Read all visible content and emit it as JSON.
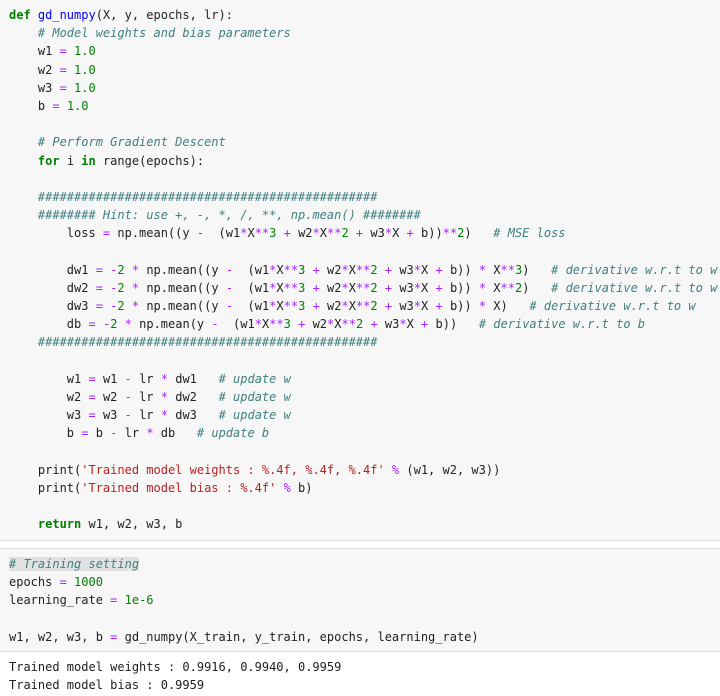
{
  "cell1": {
    "lines": [
      [
        {
          "t": "def ",
          "c": "k"
        },
        {
          "t": "gd_numpy",
          "c": "fn"
        },
        {
          "t": "(X, y, epochs, lr):"
        }
      ],
      [
        {
          "t": "    "
        },
        {
          "t": "# Model weights and bias parameters",
          "c": "c"
        }
      ],
      [
        {
          "t": "    w1 "
        },
        {
          "t": "=",
          "c": "op"
        },
        {
          "t": " "
        },
        {
          "t": "1.0",
          "c": "n"
        }
      ],
      [
        {
          "t": "    w2 "
        },
        {
          "t": "=",
          "c": "op"
        },
        {
          "t": " "
        },
        {
          "t": "1.0",
          "c": "n"
        }
      ],
      [
        {
          "t": "    w3 "
        },
        {
          "t": "=",
          "c": "op"
        },
        {
          "t": " "
        },
        {
          "t": "1.0",
          "c": "n"
        }
      ],
      [
        {
          "t": "    b "
        },
        {
          "t": "=",
          "c": "op"
        },
        {
          "t": " "
        },
        {
          "t": "1.0",
          "c": "n"
        }
      ],
      [],
      [
        {
          "t": "    "
        },
        {
          "t": "# Perform Gradient Descent",
          "c": "c"
        }
      ],
      [
        {
          "t": "    "
        },
        {
          "t": "for",
          "c": "k"
        },
        {
          "t": " i "
        },
        {
          "t": "in",
          "c": "k"
        },
        {
          "t": " range(epochs):"
        }
      ],
      [],
      [
        {
          "t": "    "
        },
        {
          "t": "###############################################",
          "c": "c"
        }
      ],
      [
        {
          "t": "    "
        },
        {
          "t": "######## Hint: use +, -, *, /, **, np.mean() ########",
          "c": "c"
        }
      ],
      [
        {
          "t": "        loss "
        },
        {
          "t": "=",
          "c": "op"
        },
        {
          "t": " np.mean((y "
        },
        {
          "t": "-",
          "c": "op"
        },
        {
          "t": "  (w1"
        },
        {
          "t": "*",
          "c": "op"
        },
        {
          "t": "X"
        },
        {
          "t": "**",
          "c": "op"
        },
        {
          "t": "3",
          "c": "n"
        },
        {
          "t": " "
        },
        {
          "t": "+",
          "c": "op"
        },
        {
          "t": " w2"
        },
        {
          "t": "*",
          "c": "op"
        },
        {
          "t": "X"
        },
        {
          "t": "**",
          "c": "op"
        },
        {
          "t": "2",
          "c": "n"
        },
        {
          "t": " "
        },
        {
          "t": "+",
          "c": "op"
        },
        {
          "t": " w3"
        },
        {
          "t": "*",
          "c": "op"
        },
        {
          "t": "X "
        },
        {
          "t": "+",
          "c": "op"
        },
        {
          "t": " b))"
        },
        {
          "t": "**",
          "c": "op"
        },
        {
          "t": "2",
          "c": "n"
        },
        {
          "t": ")   "
        },
        {
          "t": "# MSE loss",
          "c": "c"
        }
      ],
      [],
      [
        {
          "t": "        dw1 "
        },
        {
          "t": "=",
          "c": "op"
        },
        {
          "t": " "
        },
        {
          "t": "-",
          "c": "op"
        },
        {
          "t": "2",
          "c": "n"
        },
        {
          "t": " "
        },
        {
          "t": "*",
          "c": "op"
        },
        {
          "t": " np.mean((y "
        },
        {
          "t": "-",
          "c": "op"
        },
        {
          "t": "  (w1"
        },
        {
          "t": "*",
          "c": "op"
        },
        {
          "t": "X"
        },
        {
          "t": "**",
          "c": "op"
        },
        {
          "t": "3",
          "c": "n"
        },
        {
          "t": " "
        },
        {
          "t": "+",
          "c": "op"
        },
        {
          "t": " w2"
        },
        {
          "t": "*",
          "c": "op"
        },
        {
          "t": "X"
        },
        {
          "t": "**",
          "c": "op"
        },
        {
          "t": "2",
          "c": "n"
        },
        {
          "t": " "
        },
        {
          "t": "+",
          "c": "op"
        },
        {
          "t": " w3"
        },
        {
          "t": "*",
          "c": "op"
        },
        {
          "t": "X "
        },
        {
          "t": "+",
          "c": "op"
        },
        {
          "t": " b)) "
        },
        {
          "t": "*",
          "c": "op"
        },
        {
          "t": " X"
        },
        {
          "t": "**",
          "c": "op"
        },
        {
          "t": "3",
          "c": "n"
        },
        {
          "t": ")   "
        },
        {
          "t": "# derivative w.r.t to w",
          "c": "c"
        }
      ],
      [
        {
          "t": "        dw2 "
        },
        {
          "t": "=",
          "c": "op"
        },
        {
          "t": " "
        },
        {
          "t": "-",
          "c": "op"
        },
        {
          "t": "2",
          "c": "n"
        },
        {
          "t": " "
        },
        {
          "t": "*",
          "c": "op"
        },
        {
          "t": " np.mean((y "
        },
        {
          "t": "-",
          "c": "op"
        },
        {
          "t": "  (w1"
        },
        {
          "t": "*",
          "c": "op"
        },
        {
          "t": "X"
        },
        {
          "t": "**",
          "c": "op"
        },
        {
          "t": "3",
          "c": "n"
        },
        {
          "t": " "
        },
        {
          "t": "+",
          "c": "op"
        },
        {
          "t": " w2"
        },
        {
          "t": "*",
          "c": "op"
        },
        {
          "t": "X"
        },
        {
          "t": "**",
          "c": "op"
        },
        {
          "t": "2",
          "c": "n"
        },
        {
          "t": " "
        },
        {
          "t": "+",
          "c": "op"
        },
        {
          "t": " w3"
        },
        {
          "t": "*",
          "c": "op"
        },
        {
          "t": "X "
        },
        {
          "t": "+",
          "c": "op"
        },
        {
          "t": " b)) "
        },
        {
          "t": "*",
          "c": "op"
        },
        {
          "t": " X"
        },
        {
          "t": "**",
          "c": "op"
        },
        {
          "t": "2",
          "c": "n"
        },
        {
          "t": ")   "
        },
        {
          "t": "# derivative w.r.t to w",
          "c": "c"
        }
      ],
      [
        {
          "t": "        dw3 "
        },
        {
          "t": "=",
          "c": "op"
        },
        {
          "t": " "
        },
        {
          "t": "-",
          "c": "op"
        },
        {
          "t": "2",
          "c": "n"
        },
        {
          "t": " "
        },
        {
          "t": "*",
          "c": "op"
        },
        {
          "t": " np.mean((y "
        },
        {
          "t": "-",
          "c": "op"
        },
        {
          "t": "  (w1"
        },
        {
          "t": "*",
          "c": "op"
        },
        {
          "t": "X"
        },
        {
          "t": "**",
          "c": "op"
        },
        {
          "t": "3",
          "c": "n"
        },
        {
          "t": " "
        },
        {
          "t": "+",
          "c": "op"
        },
        {
          "t": " w2"
        },
        {
          "t": "*",
          "c": "op"
        },
        {
          "t": "X"
        },
        {
          "t": "**",
          "c": "op"
        },
        {
          "t": "2",
          "c": "n"
        },
        {
          "t": " "
        },
        {
          "t": "+",
          "c": "op"
        },
        {
          "t": " w3"
        },
        {
          "t": "*",
          "c": "op"
        },
        {
          "t": "X "
        },
        {
          "t": "+",
          "c": "op"
        },
        {
          "t": " b)) "
        },
        {
          "t": "*",
          "c": "op"
        },
        {
          "t": " X)   "
        },
        {
          "t": "# derivative w.r.t to w",
          "c": "c"
        }
      ],
      [
        {
          "t": "        db "
        },
        {
          "t": "=",
          "c": "op"
        },
        {
          "t": " "
        },
        {
          "t": "-",
          "c": "op"
        },
        {
          "t": "2",
          "c": "n"
        },
        {
          "t": " "
        },
        {
          "t": "*",
          "c": "op"
        },
        {
          "t": " np.mean(y "
        },
        {
          "t": "-",
          "c": "op"
        },
        {
          "t": "  (w1"
        },
        {
          "t": "*",
          "c": "op"
        },
        {
          "t": "X"
        },
        {
          "t": "**",
          "c": "op"
        },
        {
          "t": "3",
          "c": "n"
        },
        {
          "t": " "
        },
        {
          "t": "+",
          "c": "op"
        },
        {
          "t": " w2"
        },
        {
          "t": "*",
          "c": "op"
        },
        {
          "t": "X"
        },
        {
          "t": "**",
          "c": "op"
        },
        {
          "t": "2",
          "c": "n"
        },
        {
          "t": " "
        },
        {
          "t": "+",
          "c": "op"
        },
        {
          "t": " w3"
        },
        {
          "t": "*",
          "c": "op"
        },
        {
          "t": "X "
        },
        {
          "t": "+",
          "c": "op"
        },
        {
          "t": " b))   "
        },
        {
          "t": "# derivative w.r.t to b",
          "c": "c"
        }
      ],
      [
        {
          "t": "    "
        },
        {
          "t": "###############################################",
          "c": "c"
        }
      ],
      [],
      [
        {
          "t": "        w1 "
        },
        {
          "t": "=",
          "c": "op"
        },
        {
          "t": " w1 "
        },
        {
          "t": "-",
          "c": "op"
        },
        {
          "t": " lr "
        },
        {
          "t": "*",
          "c": "op"
        },
        {
          "t": " dw1   "
        },
        {
          "t": "# update w",
          "c": "c"
        }
      ],
      [
        {
          "t": "        w2 "
        },
        {
          "t": "=",
          "c": "op"
        },
        {
          "t": " w2 "
        },
        {
          "t": "-",
          "c": "op"
        },
        {
          "t": " lr "
        },
        {
          "t": "*",
          "c": "op"
        },
        {
          "t": " dw2   "
        },
        {
          "t": "# update w",
          "c": "c"
        }
      ],
      [
        {
          "t": "        w3 "
        },
        {
          "t": "=",
          "c": "op"
        },
        {
          "t": " w3 "
        },
        {
          "t": "-",
          "c": "op"
        },
        {
          "t": " lr "
        },
        {
          "t": "*",
          "c": "op"
        },
        {
          "t": " dw3   "
        },
        {
          "t": "# update w",
          "c": "c"
        }
      ],
      [
        {
          "t": "        b "
        },
        {
          "t": "=",
          "c": "op"
        },
        {
          "t": " b "
        },
        {
          "t": "-",
          "c": "op"
        },
        {
          "t": " lr "
        },
        {
          "t": "*",
          "c": "op"
        },
        {
          "t": " db   "
        },
        {
          "t": "# update b",
          "c": "c"
        }
      ],
      [],
      [
        {
          "t": "    print("
        },
        {
          "t": "'Trained model weights : %.4f, %.4f, %.4f'",
          "c": "s"
        },
        {
          "t": " "
        },
        {
          "t": "%",
          "c": "op"
        },
        {
          "t": " (w1, w2, w3))"
        }
      ],
      [
        {
          "t": "    print("
        },
        {
          "t": "'Trained model bias : %.4f'",
          "c": "s"
        },
        {
          "t": " "
        },
        {
          "t": "%",
          "c": "op"
        },
        {
          "t": " b)"
        }
      ],
      [],
      [
        {
          "t": "    "
        },
        {
          "t": "return",
          "c": "k"
        },
        {
          "t": " w1, w2, w3, b"
        }
      ]
    ]
  },
  "cell2": {
    "lines": [
      [
        {
          "t": "# Training setting",
          "c": "c hl"
        }
      ],
      [
        {
          "t": "epochs "
        },
        {
          "t": "=",
          "c": "op"
        },
        {
          "t": " "
        },
        {
          "t": "1000",
          "c": "n"
        }
      ],
      [
        {
          "t": "learning_rate "
        },
        {
          "t": "=",
          "c": "op"
        },
        {
          "t": " "
        },
        {
          "t": "1e-6",
          "c": "n"
        }
      ],
      [],
      [
        {
          "t": "w1, w2, w3, b "
        },
        {
          "t": "=",
          "c": "op"
        },
        {
          "t": " gd_numpy(X_train, y_train, epochs, learning_rate)"
        }
      ]
    ]
  },
  "output": {
    "lines": [
      [
        {
          "t": "Trained model weights : 0.9916, 0.9940, 0.9959"
        }
      ],
      [
        {
          "t": "Trained model bias : 0.9959"
        }
      ]
    ]
  }
}
